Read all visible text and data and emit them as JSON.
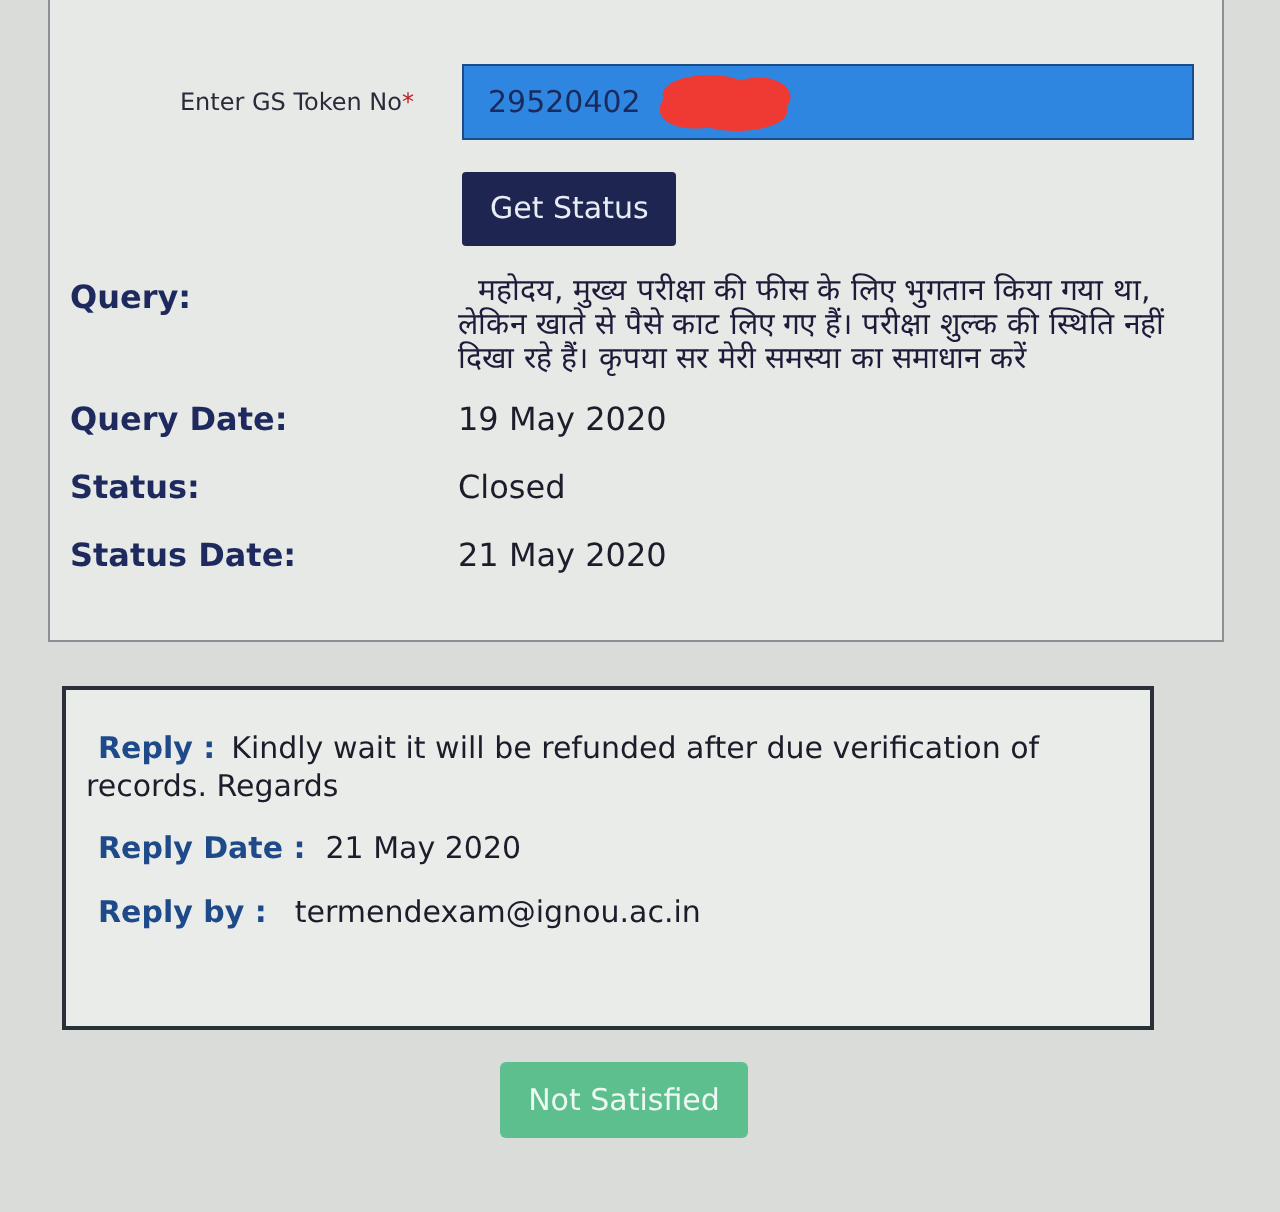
{
  "token_field": {
    "label": "Enter GS Token No",
    "required_mark": "*",
    "value": "29520402",
    "redacted": true
  },
  "get_status_button": "Get Status",
  "details": [
    {
      "label": "Query:",
      "value": "महोदय, मुख्य परीक्षा की फीस के लिए भुगतान किया गया था, लेकिन खाते से पैसे काट लिए गए हैं। परीक्षा शुल्क की स्थिति नहीं दिखा रहे हैं। कृपया सर मेरी समस्या का समाधान करें",
      "kind": "paragraph"
    },
    {
      "label": "Query Date:",
      "value": "19 May 2020",
      "kind": "line"
    },
    {
      "label": "Status:",
      "value": "Closed",
      "kind": "line"
    },
    {
      "label": "Status Date:",
      "value": "21 May 2020",
      "kind": "line"
    }
  ],
  "reply": {
    "reply_label": "Reply :",
    "reply_text": "Kindly wait it will be refunded after due verification of records. Regards",
    "date_label": "Reply Date :",
    "date": "21 May 2020",
    "by_label": "Reply by :",
    "by": "termendexam@ignou.ac.in"
  },
  "not_satisfied_button": "Not Satisfied"
}
